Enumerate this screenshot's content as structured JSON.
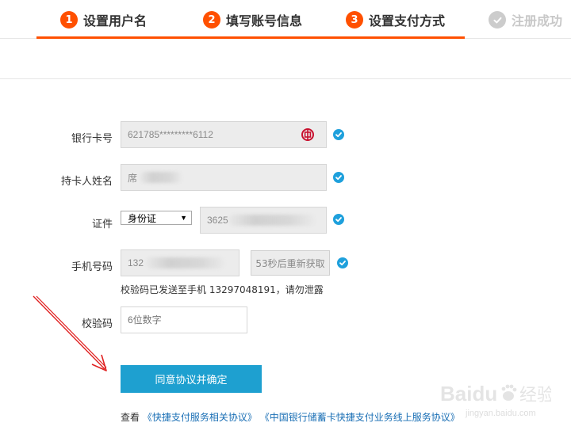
{
  "steps": [
    {
      "number": "1",
      "label": "设置用户名",
      "state": "active"
    },
    {
      "number": "2",
      "label": "填写账号信息",
      "state": "active"
    },
    {
      "number": "3",
      "label": "设置支付方式",
      "state": "active"
    },
    {
      "number": "",
      "label": "注册成功",
      "state": "done"
    }
  ],
  "form": {
    "card_number_label": "银行卡号",
    "card_number_value": "621785*********6112",
    "cardholder_label": "持卡人姓名",
    "cardholder_value": "席",
    "id_label": "证件",
    "id_type": "身份证",
    "id_number_value": "3625",
    "phone_label": "手机号码",
    "phone_value": "132",
    "resend_label": "53秒后重新获取",
    "sent_note": "校验码已发送至手机 13297048191，请勿泄露",
    "code_label": "校验码",
    "code_placeholder": "6位数字",
    "submit_label": "同意协议并确定"
  },
  "agreement": {
    "prefix": "查看",
    "link1": "《快捷支付服务相关协议》",
    "link2": "《中国银行储蓄卡快捷支付业务线上服务协议》"
  },
  "watermark": {
    "brand": "Baidu",
    "brand_cn": "经验",
    "sub": "jingyan.baidu.com"
  },
  "colors": {
    "accent_orange": "#ff5000",
    "check_blue": "#1ea0dc",
    "button_blue": "#1ea0d0",
    "link_blue": "#1a6fb5",
    "annotation_red": "#e02020"
  },
  "icons": {
    "bank_logo": "bank-of-china-icon",
    "valid": "check-circle-icon",
    "done_step": "check-circle-icon"
  }
}
